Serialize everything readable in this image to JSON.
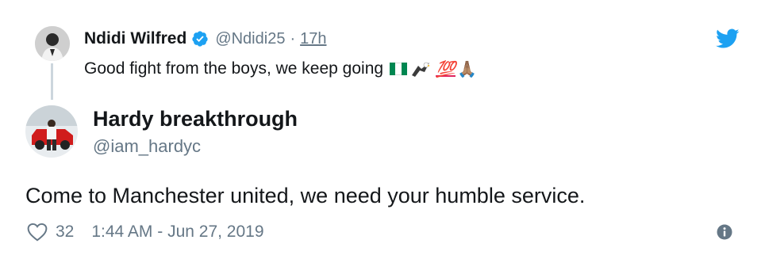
{
  "parent_tweet": {
    "name": "Ndidi Wilfred",
    "handle": "@Ndidi25",
    "separator": "·",
    "time": "17h",
    "text": "Good fight from the boys, we keep going",
    "emojis": {
      "flag": "nigeria-flag-emoji",
      "eagle": "eagle-emoji",
      "hundred": "💯",
      "pray": "🙏🏽"
    },
    "verified_icon": "verified-badge-icon"
  },
  "main_tweet": {
    "name": "Hardy breakthrough",
    "handle": "@iam_hardyc",
    "text": "Come to Manchester united, we need your humble service.",
    "likes": "32",
    "timestamp": "1:44 AM - Jun 27, 2019"
  },
  "icons": {
    "brand": "twitter-bird-icon",
    "like": "heart-outline-icon",
    "info": "info-icon"
  },
  "colors": {
    "brand_blue": "#1da1f2",
    "secondary_text": "#657786",
    "thread_line": "#ccd6dd"
  }
}
